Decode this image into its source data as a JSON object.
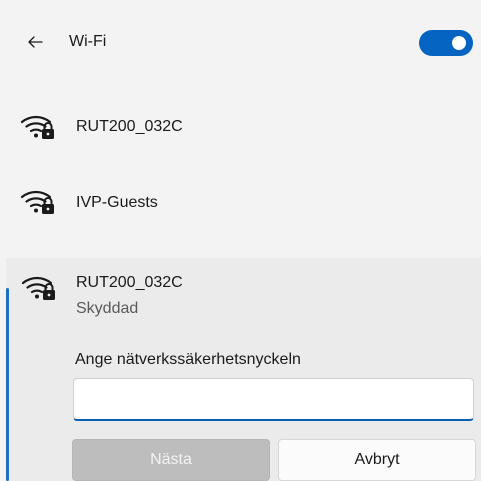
{
  "header": {
    "back_icon": "arrow-left-icon",
    "title": "Wi-Fi",
    "toggle_on": true,
    "accent_color": "#0563c1"
  },
  "networks": [
    {
      "name": "RUT200_032C",
      "icon": "wifi-secured-icon"
    },
    {
      "name": "IVP-Guests",
      "icon": "wifi-secured-icon"
    }
  ],
  "expanded": {
    "name": "RUT200_032C",
    "status": "Skyddad",
    "icon": "wifi-secured-icon",
    "prompt": "Ange nätverkssäkerhetsnyckeln",
    "key_value": "",
    "next_label": "Nästa",
    "cancel_label": "Avbryt"
  }
}
